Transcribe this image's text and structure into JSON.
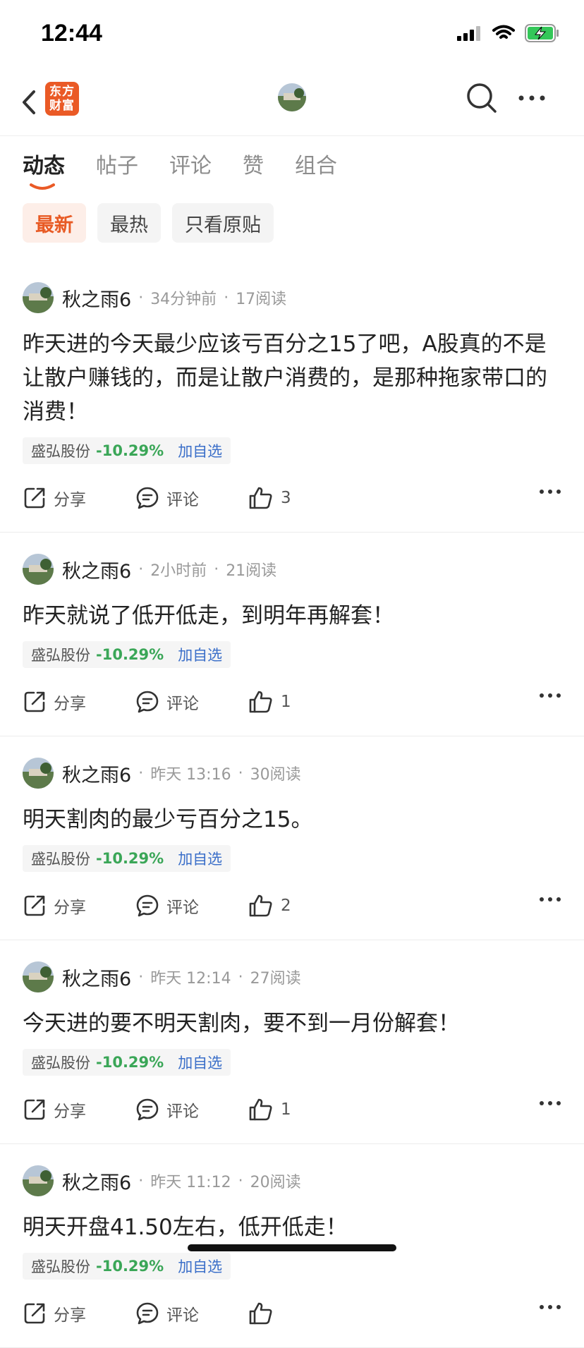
{
  "status_bar": {
    "time": "12:44"
  },
  "navbar": {
    "logo_text": "东方财富"
  },
  "tabs": [
    {
      "label": "动态",
      "active": true
    },
    {
      "label": "帖子",
      "active": false
    },
    {
      "label": "评论",
      "active": false
    },
    {
      "label": "赞",
      "active": false
    },
    {
      "label": "组合",
      "active": false
    }
  ],
  "filters": [
    {
      "label": "最新",
      "active": true
    },
    {
      "label": "最热",
      "active": false
    },
    {
      "label": "只看原贴",
      "active": false
    }
  ],
  "posts": [
    {
      "author": "秋之雨6",
      "time": "34分钟前",
      "reads": "17阅读",
      "text": "昨天进的今天最少应该亏百分之15了吧，A股真的不是让散户赚钱的，而是让散户消费的，是那种拖家带口的消费！",
      "stock_name": "盛弘股份",
      "stock_change": "-10.29%",
      "stock_add": "加自选",
      "share_label": "分享",
      "comment_label": "评论",
      "likes": "3"
    },
    {
      "author": "秋之雨6",
      "time": "2小时前",
      "reads": "21阅读",
      "text": "昨天就说了低开低走，到明年再解套！",
      "stock_name": "盛弘股份",
      "stock_change": "-10.29%",
      "stock_add": "加自选",
      "share_label": "分享",
      "comment_label": "评论",
      "likes": "1"
    },
    {
      "author": "秋之雨6",
      "time": "昨天 13:16",
      "reads": "30阅读",
      "text": "明天割肉的最少亏百分之15。",
      "stock_name": "盛弘股份",
      "stock_change": "-10.29%",
      "stock_add": "加自选",
      "share_label": "分享",
      "comment_label": "评论",
      "likes": "2"
    },
    {
      "author": "秋之雨6",
      "time": "昨天 12:14",
      "reads": "27阅读",
      "text": "今天进的要不明天割肉，要不到一月份解套！",
      "stock_name": "盛弘股份",
      "stock_change": "-10.29%",
      "stock_add": "加自选",
      "share_label": "分享",
      "comment_label": "评论",
      "likes": "1"
    },
    {
      "author": "秋之雨6",
      "time": "昨天 11:12",
      "reads": "20阅读",
      "text": "明天开盘41.50左右，低开低走！",
      "stock_name": "盛弘股份",
      "stock_change": "-10.29%",
      "stock_add": "加自选",
      "share_label": "分享",
      "comment_label": "评论",
      "likes": ""
    }
  ]
}
